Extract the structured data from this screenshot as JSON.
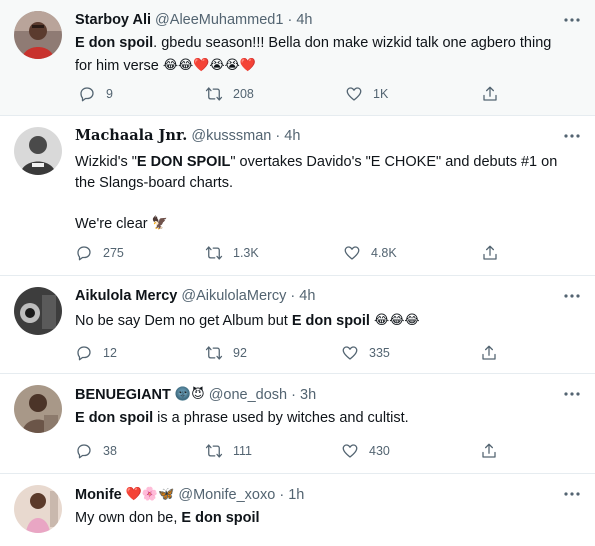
{
  "tweets": [
    {
      "name": "Starboy Ali",
      "handle": "@AleeMuhammed1",
      "time": "4h",
      "text_bold": "E don spoil",
      "text_rest": ". gbedu season!!! Bella don make wizkid talk one agbero thing",
      "text_line2": "for him verse",
      "text_line2_emoji": "😂😂❤️😭😭❤️",
      "replies": "9",
      "retweets": "208",
      "likes": "1K",
      "avatar_icon": "avatar-red-shirt"
    },
    {
      "name": "Machaala Jnr.",
      "handle": "@kusssman",
      "time": "4h",
      "line1_pre": "Wizkid's \"",
      "line1_bold": "E DON SPOIL",
      "line1_post": "\" overtakes Davido's \"E CHOKE\" and debuts #1 on",
      "line2": "the Slangs-board charts.",
      "line3": "We're clear",
      "line3_emoji": "🦅",
      "replies": "275",
      "retweets": "1.3K",
      "likes": "4.8K",
      "avatar_icon": "avatar-grey-man"
    },
    {
      "name": "Aikulola Mercy",
      "handle": "@AikulolaMercy",
      "time": "4h",
      "text_pre": "No be say Dem no get Album but ",
      "text_bold": "E don spoil",
      "text_emoji": "😂😂😂",
      "replies": "12",
      "retweets": "92",
      "likes": "335",
      "avatar_icon": "avatar-eye-dark"
    },
    {
      "name": "BENUEGIANT",
      "name_emoji": "🌚😈",
      "handle": "@one_dosh",
      "time": "3h",
      "text_bold": "E don spoil",
      "text_rest": " is a phrase used by witches and cultist.",
      "replies": "38",
      "retweets": "111",
      "likes": "430",
      "avatar_icon": "avatar-brown-man"
    },
    {
      "name": "Monife",
      "name_emoji": "❤️🌸🦋",
      "handle": "@Monife_xoxo",
      "time": "1h",
      "text_pre": "My own don be, ",
      "text_bold": "E don spoil",
      "avatar_icon": "avatar-pink-dress"
    }
  ],
  "separator": "·",
  "colors": {
    "muted": "#536471",
    "text": "#0f1419",
    "border": "#e6ecf0",
    "shaded_bg": "#f7f9f9"
  },
  "icons": [
    "reply-icon",
    "retweet-icon",
    "like-icon",
    "share-icon",
    "more-icon"
  ]
}
